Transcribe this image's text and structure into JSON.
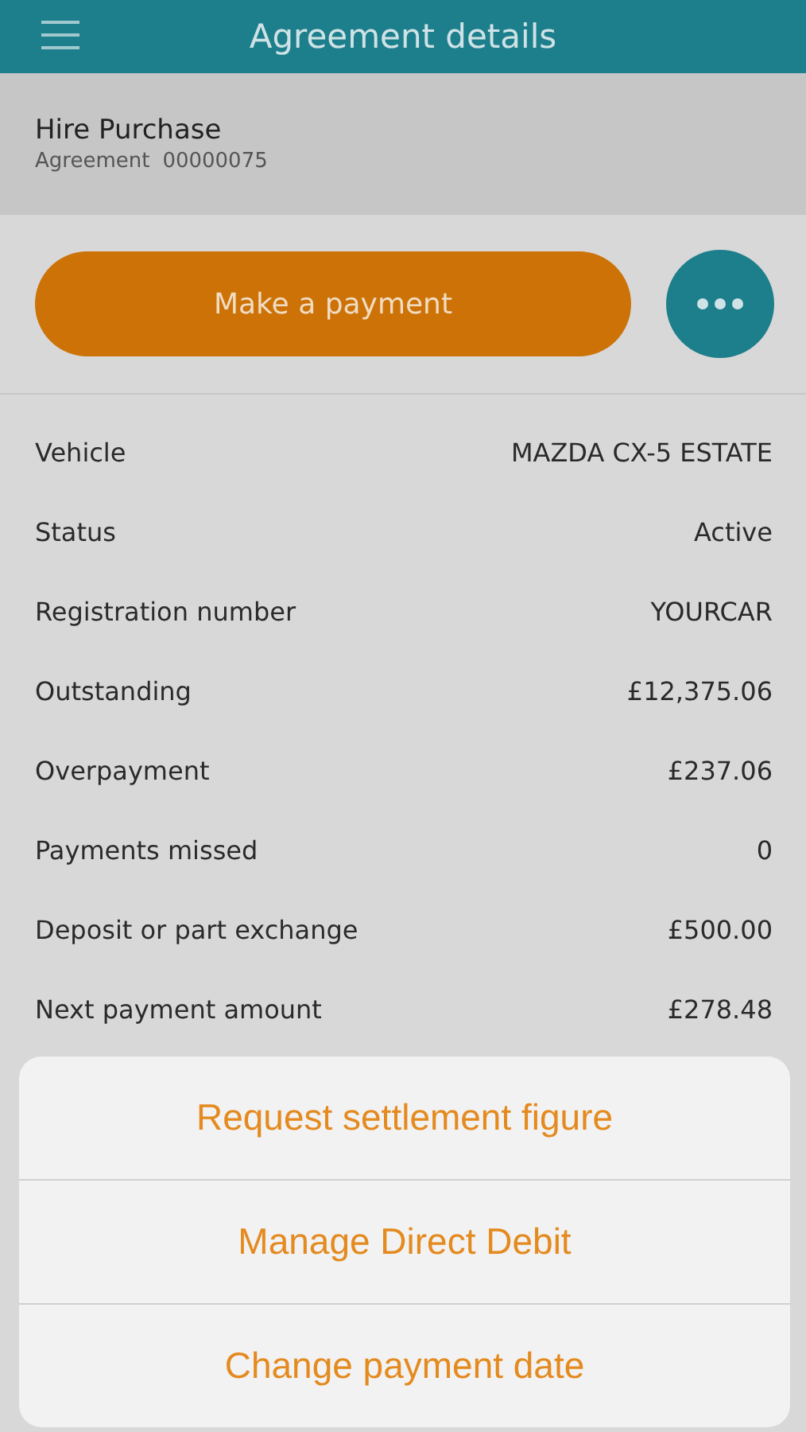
{
  "header": {
    "title": "Agreement details"
  },
  "agreement": {
    "type": "Hire Purchase",
    "number_label": "Agreement",
    "number": "00000075"
  },
  "primary_button": "Make a payment",
  "details": [
    {
      "label": "Vehicle",
      "value": "MAZDA CX-5 ESTATE"
    },
    {
      "label": "Status",
      "value": "Active"
    },
    {
      "label": "Registration number",
      "value": "YOURCAR"
    },
    {
      "label": "Outstanding",
      "value": "£12,375.06"
    },
    {
      "label": "Overpayment",
      "value": "£237.06"
    },
    {
      "label": "Payments missed",
      "value": "0"
    },
    {
      "label": "Deposit or part exchange",
      "value": "£500.00"
    },
    {
      "label": "Next payment amount",
      "value": "£278.48"
    }
  ],
  "action_sheet": [
    "Request settlement figure",
    "Manage Direct Debit",
    "Change payment date"
  ]
}
